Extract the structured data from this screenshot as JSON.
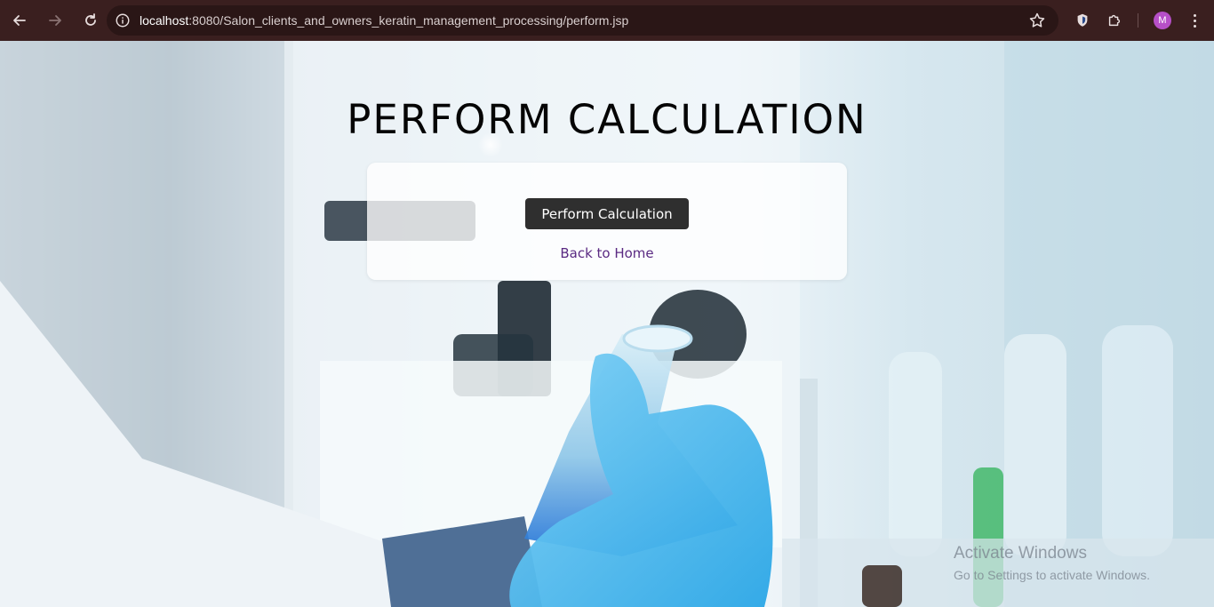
{
  "browser": {
    "url_host": "localhost",
    "url_rest": ":8080/Salon_clients_and_owners_keratin_management_processing/perform.jsp",
    "profile_initial": "M"
  },
  "page": {
    "title": "PERFORM CALCULATION",
    "perform_button": "Perform Calculation",
    "back_link": "Back to Home"
  },
  "watermark": {
    "line1": "Activate Windows",
    "line2": "Go to Settings to activate Windows."
  },
  "colors": {
    "chrome_bg": "#3a1f1f",
    "button_bg": "#2f2f2f",
    "link_color": "#5a2a82",
    "avatar": "#b64fc7"
  }
}
